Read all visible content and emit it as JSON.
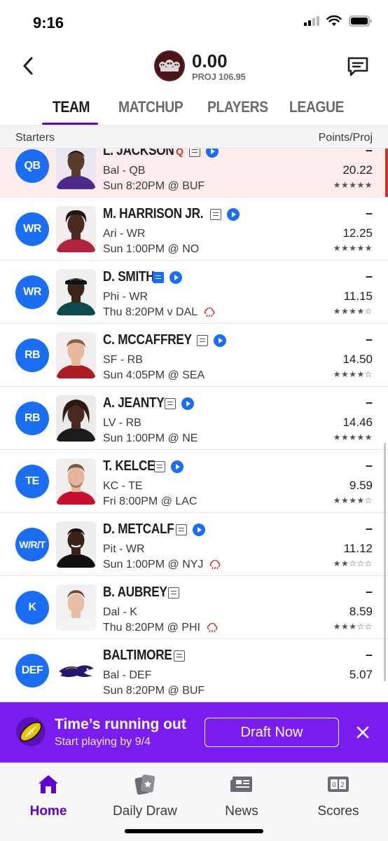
{
  "status_bar": {
    "time": "9:16"
  },
  "header": {
    "score": "0.00",
    "proj": "PROJ 106.95"
  },
  "tabs": [
    {
      "label": "TEAM",
      "active": true
    },
    {
      "label": "MATCHUP",
      "active": false
    },
    {
      "label": "PLAYERS",
      "active": false
    },
    {
      "label": "LEAGUE",
      "active": false
    }
  ],
  "section": {
    "left": "Starters",
    "right": "Points/Proj"
  },
  "players": [
    {
      "pos": "QB",
      "name": "L. JACKSON",
      "status": "Q",
      "team_pos": "Bal - QB",
      "game": "Sun 8:20PM @ BUF",
      "points": "–",
      "proj": "20.22",
      "stars": "★★★★★",
      "notes_blue": false,
      "video": true,
      "weather": false
    },
    {
      "pos": "WR",
      "name": "M. HARRISON JR.",
      "status": "",
      "team_pos": "Ari - WR",
      "game": "Sun 1:00PM @ NO",
      "points": "–",
      "proj": "12.25",
      "stars": "★★★★★",
      "notes_blue": false,
      "video": true,
      "weather": false
    },
    {
      "pos": "WR",
      "name": "D. SMITH",
      "status": "",
      "team_pos": "Phi - WR",
      "game": "Thu 8:20PM v DAL",
      "points": "–",
      "proj": "11.15",
      "stars": "★★★★☆",
      "notes_blue": true,
      "video": true,
      "weather": true
    },
    {
      "pos": "RB",
      "name": "C. MCCAFFREY",
      "status": "",
      "team_pos": "SF - RB",
      "game": "Sun 4:05PM @ SEA",
      "points": "–",
      "proj": "14.50",
      "stars": "★★★★☆",
      "notes_blue": false,
      "video": true,
      "weather": false
    },
    {
      "pos": "RB",
      "name": "A. JEANTY",
      "status": "",
      "team_pos": "LV - RB",
      "game": "Sun 1:00PM @ NE",
      "points": "–",
      "proj": "14.46",
      "stars": "★★★★★",
      "notes_blue": false,
      "video": true,
      "weather": false
    },
    {
      "pos": "TE",
      "name": "T. KELCE",
      "status": "",
      "team_pos": "KC - TE",
      "game": "Fri 8:00PM @ LAC",
      "points": "–",
      "proj": "9.59",
      "stars": "★★★★☆",
      "notes_blue": false,
      "video": true,
      "weather": false
    },
    {
      "pos": "W/R/T",
      "name": "D. METCALF",
      "status": "",
      "team_pos": "Pit - WR",
      "game": "Sun 1:00PM @ NYJ",
      "points": "–",
      "proj": "11.12",
      "stars": "★★☆☆☆",
      "notes_blue": false,
      "video": true,
      "weather": true
    },
    {
      "pos": "K",
      "name": "B. AUBREY",
      "status": "",
      "team_pos": "Dal - K",
      "game": "Thu 8:20PM @ PHI",
      "points": "–",
      "proj": "8.59",
      "stars": "★★★☆☆",
      "notes_blue": false,
      "video": false,
      "weather": true
    },
    {
      "pos": "DEF",
      "name": "BALTIMORE",
      "status": "",
      "team_pos": "Bal - DEF",
      "game": "Sun 8:20PM @ BUF",
      "points": "–",
      "proj": "5.07",
      "stars": "",
      "notes_blue": false,
      "video": false,
      "weather": false
    }
  ],
  "banner": {
    "title": "Time’s running out",
    "subtitle": "Start playing by 9/4",
    "button": "Draft Now"
  },
  "bottom_nav": [
    {
      "label": "Home",
      "icon": "home-icon",
      "active": true
    },
    {
      "label": "Daily Draw",
      "icon": "cards-icon",
      "active": false
    },
    {
      "label": "News",
      "icon": "news-icon",
      "active": false
    },
    {
      "label": "Scores",
      "icon": "scoreboard-icon",
      "active": false
    }
  ],
  "colors": {
    "accent": "#6001d2",
    "banner": "#7a1cf0",
    "badge": "#1a6ef5",
    "alert": "#d0312d"
  }
}
